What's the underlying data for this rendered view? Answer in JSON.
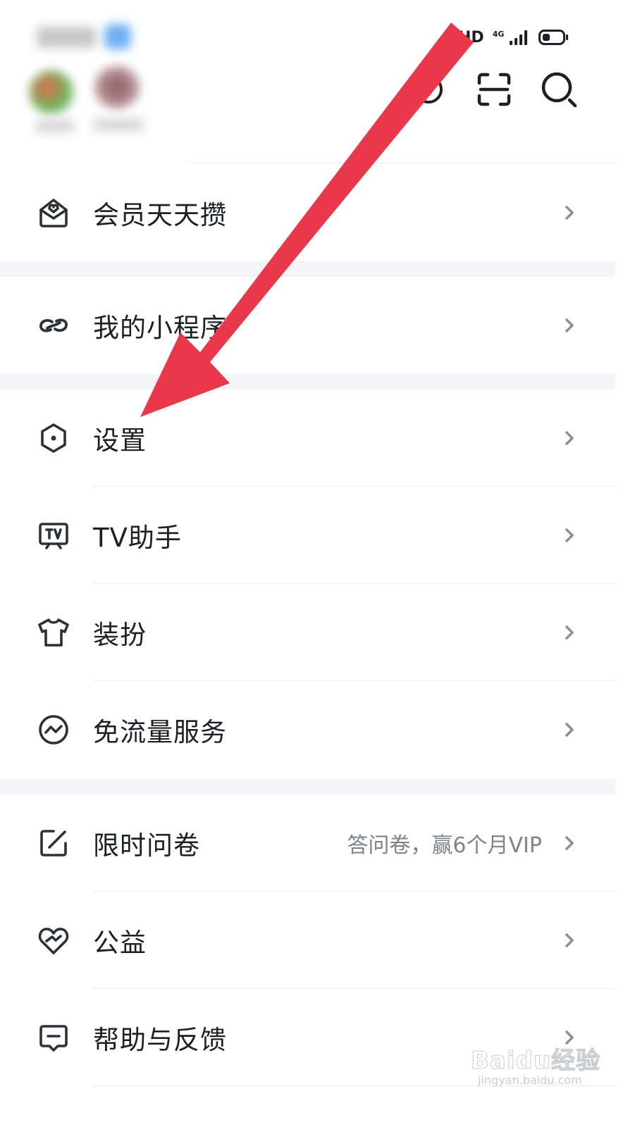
{
  "status_bar": {
    "network": "HD",
    "network_sub": "4G"
  },
  "menu": {
    "items": [
      {
        "label": "会员天天攒",
        "sub": ""
      },
      {
        "label": "我的小程序",
        "sub": ""
      },
      {
        "label": "设置",
        "sub": ""
      },
      {
        "label": "TV助手",
        "sub": ""
      },
      {
        "label": "装扮",
        "sub": ""
      },
      {
        "label": "免流量服务",
        "sub": ""
      },
      {
        "label": "限时问卷",
        "sub": "答问卷，赢6个月VIP"
      },
      {
        "label": "公益",
        "sub": ""
      },
      {
        "label": "帮助与反馈",
        "sub": ""
      }
    ]
  },
  "watermark": {
    "main": "Baidu经验",
    "sub": "jingyan.baidu.com"
  },
  "colors": {
    "arrow": "#e8384a",
    "text": "#1b1f26",
    "subtext": "#7d838c",
    "divider": "#ececef",
    "section_bg": "#f2f4f7"
  },
  "icons": [
    "reward-icon",
    "mini-program-icon",
    "settings-icon",
    "tv-icon",
    "tshirt-icon",
    "data-saver-icon",
    "survey-edit-icon",
    "heart-icon",
    "feedback-icon",
    "scan-icon",
    "search-icon",
    "chevron-right-icon"
  ]
}
